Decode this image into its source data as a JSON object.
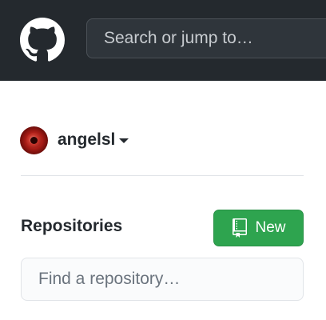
{
  "header": {
    "logo_icon": "github-octocat-icon",
    "search_placeholder": "Search or jump to…"
  },
  "user": {
    "name": "angelsl",
    "avatar_icon": "red-avatar",
    "caret_icon": "caret-down-icon"
  },
  "repositories": {
    "title": "Repositories",
    "new_button": {
      "label": "New",
      "icon": "repo-icon"
    },
    "filter_placeholder": "Find a repository…"
  },
  "colors": {
    "header_bg": "#24292e",
    "primary_button": "#2ea44f"
  }
}
